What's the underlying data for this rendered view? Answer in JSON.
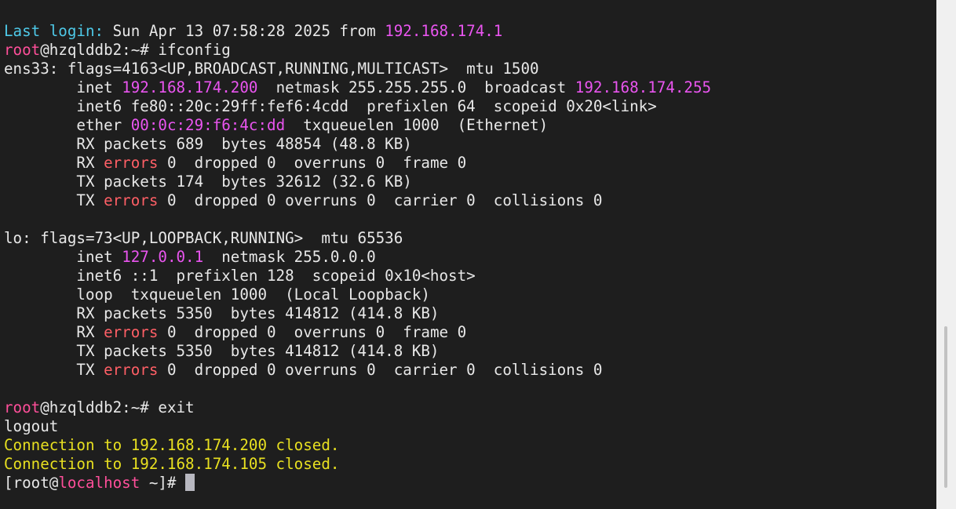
{
  "colors": {
    "background": "#1e1e1e",
    "default": "#e8e8e8",
    "cyan": "#4ec9e8",
    "magenta": "#ea55f0",
    "pink": "#ff4f9a",
    "red": "#ff5f66",
    "yellow": "#e8e020",
    "cursor": "#b8b8c0"
  },
  "lines": [
    {
      "segments": [
        {
          "text": "Last login:",
          "c": "cyan"
        },
        {
          "text": " Sun Apr 13 07:58:28 2025 from ",
          "c": "default"
        },
        {
          "text": "192.168.174.1",
          "c": "magenta"
        }
      ]
    },
    {
      "segments": [
        {
          "text": "root",
          "c": "pink"
        },
        {
          "text": "@hzqlddb2:~# ifconfig",
          "c": "default"
        }
      ]
    },
    {
      "segments": [
        {
          "text": "ens33: flags=4163<UP,BROADCAST,RUNNING,MULTICAST>  mtu 1500",
          "c": "default"
        }
      ]
    },
    {
      "segments": [
        {
          "text": "        inet ",
          "c": "default"
        },
        {
          "text": "192.168.174.200",
          "c": "magenta"
        },
        {
          "text": "  netmask 255.255.255.0  broadcast ",
          "c": "default"
        },
        {
          "text": "192.168.174.255",
          "c": "magenta"
        }
      ]
    },
    {
      "segments": [
        {
          "text": "        inet6 fe80::20c:29ff:fef6:4cdd  prefixlen 64  scopeid 0x20<link>",
          "c": "default"
        }
      ]
    },
    {
      "segments": [
        {
          "text": "        ether ",
          "c": "default"
        },
        {
          "text": "00:0c:29:f6:4c:dd",
          "c": "magenta"
        },
        {
          "text": "  txqueuelen 1000  (Ethernet)",
          "c": "default"
        }
      ]
    },
    {
      "segments": [
        {
          "text": "        RX packets 689  bytes 48854 (48.8 KB)",
          "c": "default"
        }
      ]
    },
    {
      "segments": [
        {
          "text": "        RX ",
          "c": "default"
        },
        {
          "text": "errors",
          "c": "red"
        },
        {
          "text": " 0  dropped 0  overruns 0  frame 0",
          "c": "default"
        }
      ]
    },
    {
      "segments": [
        {
          "text": "        TX packets 174  bytes 32612 (32.6 KB)",
          "c": "default"
        }
      ]
    },
    {
      "segments": [
        {
          "text": "        TX ",
          "c": "default"
        },
        {
          "text": "errors",
          "c": "red"
        },
        {
          "text": " 0  dropped 0 overruns 0  carrier 0  collisions 0",
          "c": "default"
        }
      ]
    },
    {
      "segments": []
    },
    {
      "segments": [
        {
          "text": "lo: flags=73<UP,LOOPBACK,RUNNING>  mtu 65536",
          "c": "default"
        }
      ]
    },
    {
      "segments": [
        {
          "text": "        inet ",
          "c": "default"
        },
        {
          "text": "127.0.0.1",
          "c": "magenta"
        },
        {
          "text": "  netmask 255.0.0.0",
          "c": "default"
        }
      ]
    },
    {
      "segments": [
        {
          "text": "        inet6 ::1  prefixlen 128  scopeid 0x10<host>",
          "c": "default"
        }
      ]
    },
    {
      "segments": [
        {
          "text": "        loop  txqueuelen 1000  (Local Loopback)",
          "c": "default"
        }
      ]
    },
    {
      "segments": [
        {
          "text": "        RX packets 5350  bytes 414812 (414.8 KB)",
          "c": "default"
        }
      ]
    },
    {
      "segments": [
        {
          "text": "        RX ",
          "c": "default"
        },
        {
          "text": "errors",
          "c": "red"
        },
        {
          "text": " 0  dropped 0  overruns 0  frame 0",
          "c": "default"
        }
      ]
    },
    {
      "segments": [
        {
          "text": "        TX packets 5350  bytes 414812 (414.8 KB)",
          "c": "default"
        }
      ]
    },
    {
      "segments": [
        {
          "text": "        TX ",
          "c": "default"
        },
        {
          "text": "errors",
          "c": "red"
        },
        {
          "text": " 0  dropped 0 overruns 0  carrier 0  collisions 0",
          "c": "default"
        }
      ]
    },
    {
      "segments": []
    },
    {
      "segments": [
        {
          "text": "root",
          "c": "pink"
        },
        {
          "text": "@hzqlddb2:~# exit",
          "c": "default"
        }
      ]
    },
    {
      "segments": [
        {
          "text": "logout",
          "c": "default"
        }
      ]
    },
    {
      "segments": [
        {
          "text": "Connection to 192.168.174.200 closed.",
          "c": "yellow"
        }
      ]
    },
    {
      "segments": [
        {
          "text": "Connection to 192.168.174.105 closed.",
          "c": "yellow"
        }
      ]
    },
    {
      "segments": [
        {
          "text": "[root@",
          "c": "default"
        },
        {
          "text": "localhost",
          "c": "pink"
        },
        {
          "text": " ~]# ",
          "c": "default"
        }
      ],
      "cursor": true
    }
  ]
}
